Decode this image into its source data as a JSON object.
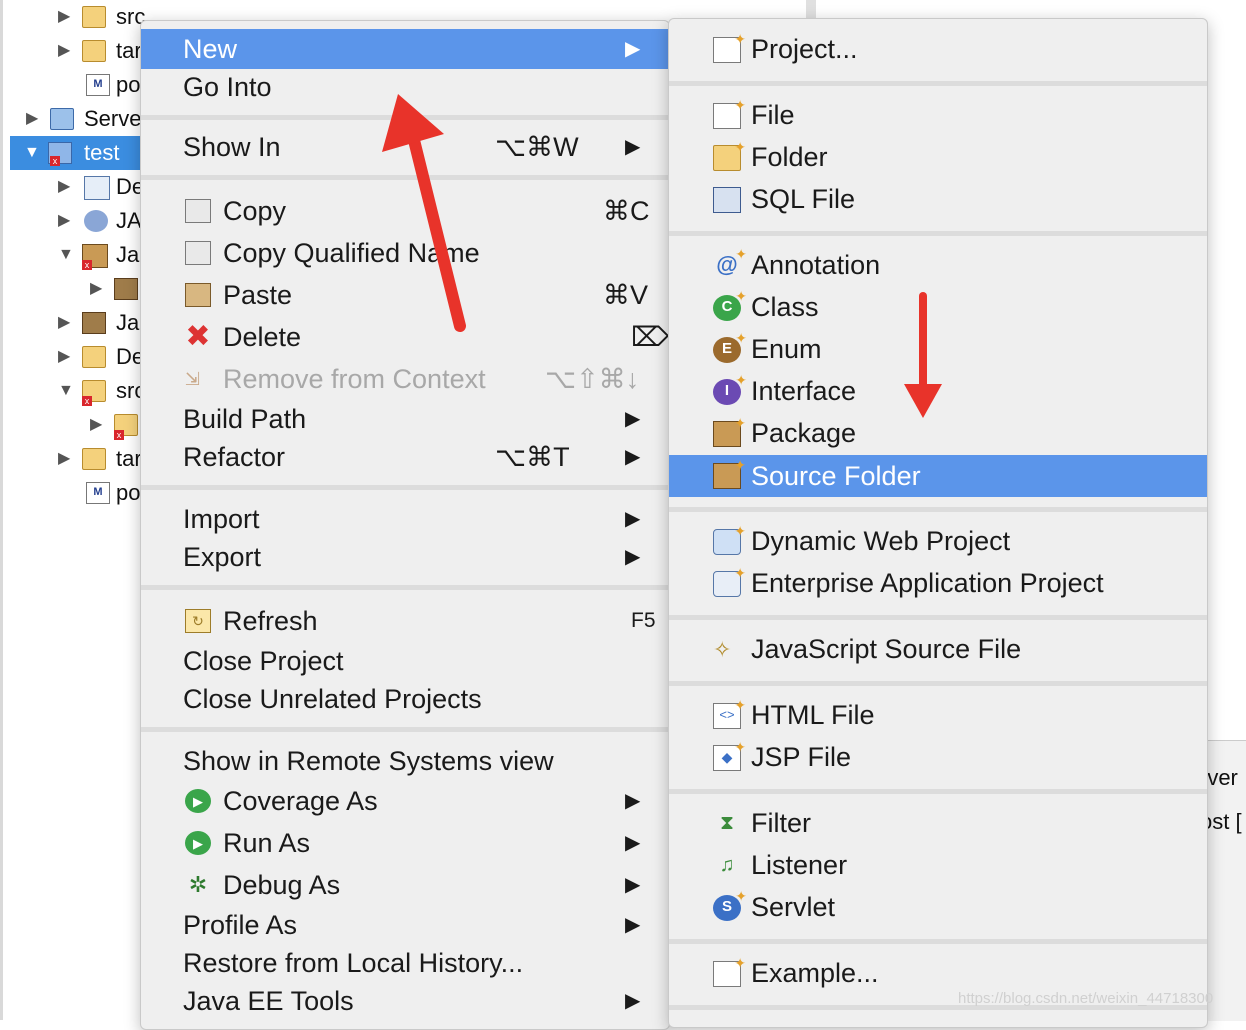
{
  "tree": {
    "rows": [
      {
        "label": "src",
        "icon": "folder-icon"
      },
      {
        "label": "tar",
        "icon": "folder-icon"
      },
      {
        "label": "po",
        "icon": "maven-file-icon"
      },
      {
        "label": "Serve",
        "icon": "servers-folder-icon"
      },
      {
        "label": "test",
        "icon": "web-project-icon"
      },
      {
        "label": "De",
        "icon": "deployment-descriptor-icon"
      },
      {
        "label": "JA",
        "icon": "jax-ws-icon"
      },
      {
        "label": "Ja",
        "icon": "java-resources-icon"
      },
      {
        "label": "",
        "icon": "library-icon"
      },
      {
        "label": "Ja",
        "icon": "library-icon"
      },
      {
        "label": "De",
        "icon": "deployed-resources-icon"
      },
      {
        "label": "src",
        "icon": "folder-icon"
      },
      {
        "label": "",
        "icon": "folder-icon"
      },
      {
        "label": "tar",
        "icon": "folder-icon"
      },
      {
        "label": "po",
        "icon": "maven-file-icon"
      }
    ]
  },
  "context_menu": {
    "items": [
      {
        "label": "New",
        "submenu": true,
        "highlighted": true
      },
      {
        "label": "Go Into"
      },
      {
        "label": "Show In",
        "shortcut": "⌥⌘W",
        "submenu": true
      },
      {
        "label": "Copy",
        "shortcut": "⌘C",
        "icon": "copy-icon"
      },
      {
        "label": "Copy Qualified Name",
        "icon": "copy-qualified-name-icon"
      },
      {
        "label": "Paste",
        "shortcut": "⌘V",
        "icon": "paste-icon"
      },
      {
        "label": "Delete",
        "shortcut": "⌦",
        "icon": "delete-icon"
      },
      {
        "label": "Remove from Context",
        "shortcut": "⌥⇧⌘↓",
        "icon": "remove-context-icon",
        "disabled": true
      },
      {
        "label": "Build Path",
        "submenu": true
      },
      {
        "label": "Refactor",
        "shortcut": "⌥⌘T",
        "submenu": true
      },
      {
        "label": "Import",
        "submenu": true
      },
      {
        "label": "Export",
        "submenu": true
      },
      {
        "label": "Refresh",
        "shortcut": "F5",
        "icon": "refresh-icon"
      },
      {
        "label": "Close Project"
      },
      {
        "label": "Close Unrelated Projects"
      },
      {
        "label": "Show in Remote Systems view"
      },
      {
        "label": "Coverage As",
        "submenu": true,
        "icon": "coverage-icon"
      },
      {
        "label": "Run As",
        "submenu": true,
        "icon": "run-icon"
      },
      {
        "label": "Debug As",
        "submenu": true,
        "icon": "debug-icon"
      },
      {
        "label": "Profile As",
        "submenu": true
      },
      {
        "label": "Restore from Local History..."
      },
      {
        "label": "Java EE Tools",
        "submenu": true
      }
    ]
  },
  "submenu": {
    "items": [
      {
        "label": "Project...",
        "icon": "new-project-icon"
      },
      {
        "label": "File",
        "icon": "new-file-icon"
      },
      {
        "label": "Folder",
        "icon": "new-folder-icon"
      },
      {
        "label": "SQL File",
        "icon": "sql-file-icon"
      },
      {
        "label": "Annotation",
        "icon": "annotation-icon"
      },
      {
        "label": "Class",
        "icon": "class-icon"
      },
      {
        "label": "Enum",
        "icon": "enum-icon"
      },
      {
        "label": "Interface",
        "icon": "interface-icon"
      },
      {
        "label": "Package",
        "icon": "package-icon"
      },
      {
        "label": "Source Folder",
        "icon": "source-folder-icon",
        "highlighted": true
      },
      {
        "label": "Dynamic Web Project",
        "icon": "dynamic-web-project-icon"
      },
      {
        "label": "Enterprise Application Project",
        "icon": "enterprise-project-icon"
      },
      {
        "label": "JavaScript Source File",
        "icon": "javascript-file-icon"
      },
      {
        "label": "HTML File",
        "icon": "html-file-icon"
      },
      {
        "label": "JSP File",
        "icon": "jsp-file-icon"
      },
      {
        "label": "Filter",
        "icon": "filter-icon"
      },
      {
        "label": "Listener",
        "icon": "listener-icon"
      },
      {
        "label": "Servlet",
        "icon": "servlet-icon"
      },
      {
        "label": "Example...",
        "icon": "example-icon"
      }
    ]
  },
  "background_panel": {
    "line1": "rver",
    "line2": "ost ["
  },
  "watermark": "https://blog.csdn.net/weixin_44718300",
  "colors": {
    "highlight": "#5b95ea",
    "menu_bg": "#efefef",
    "annotation_arrow": "#e8332a",
    "tree_selection": "#3b8de0"
  }
}
